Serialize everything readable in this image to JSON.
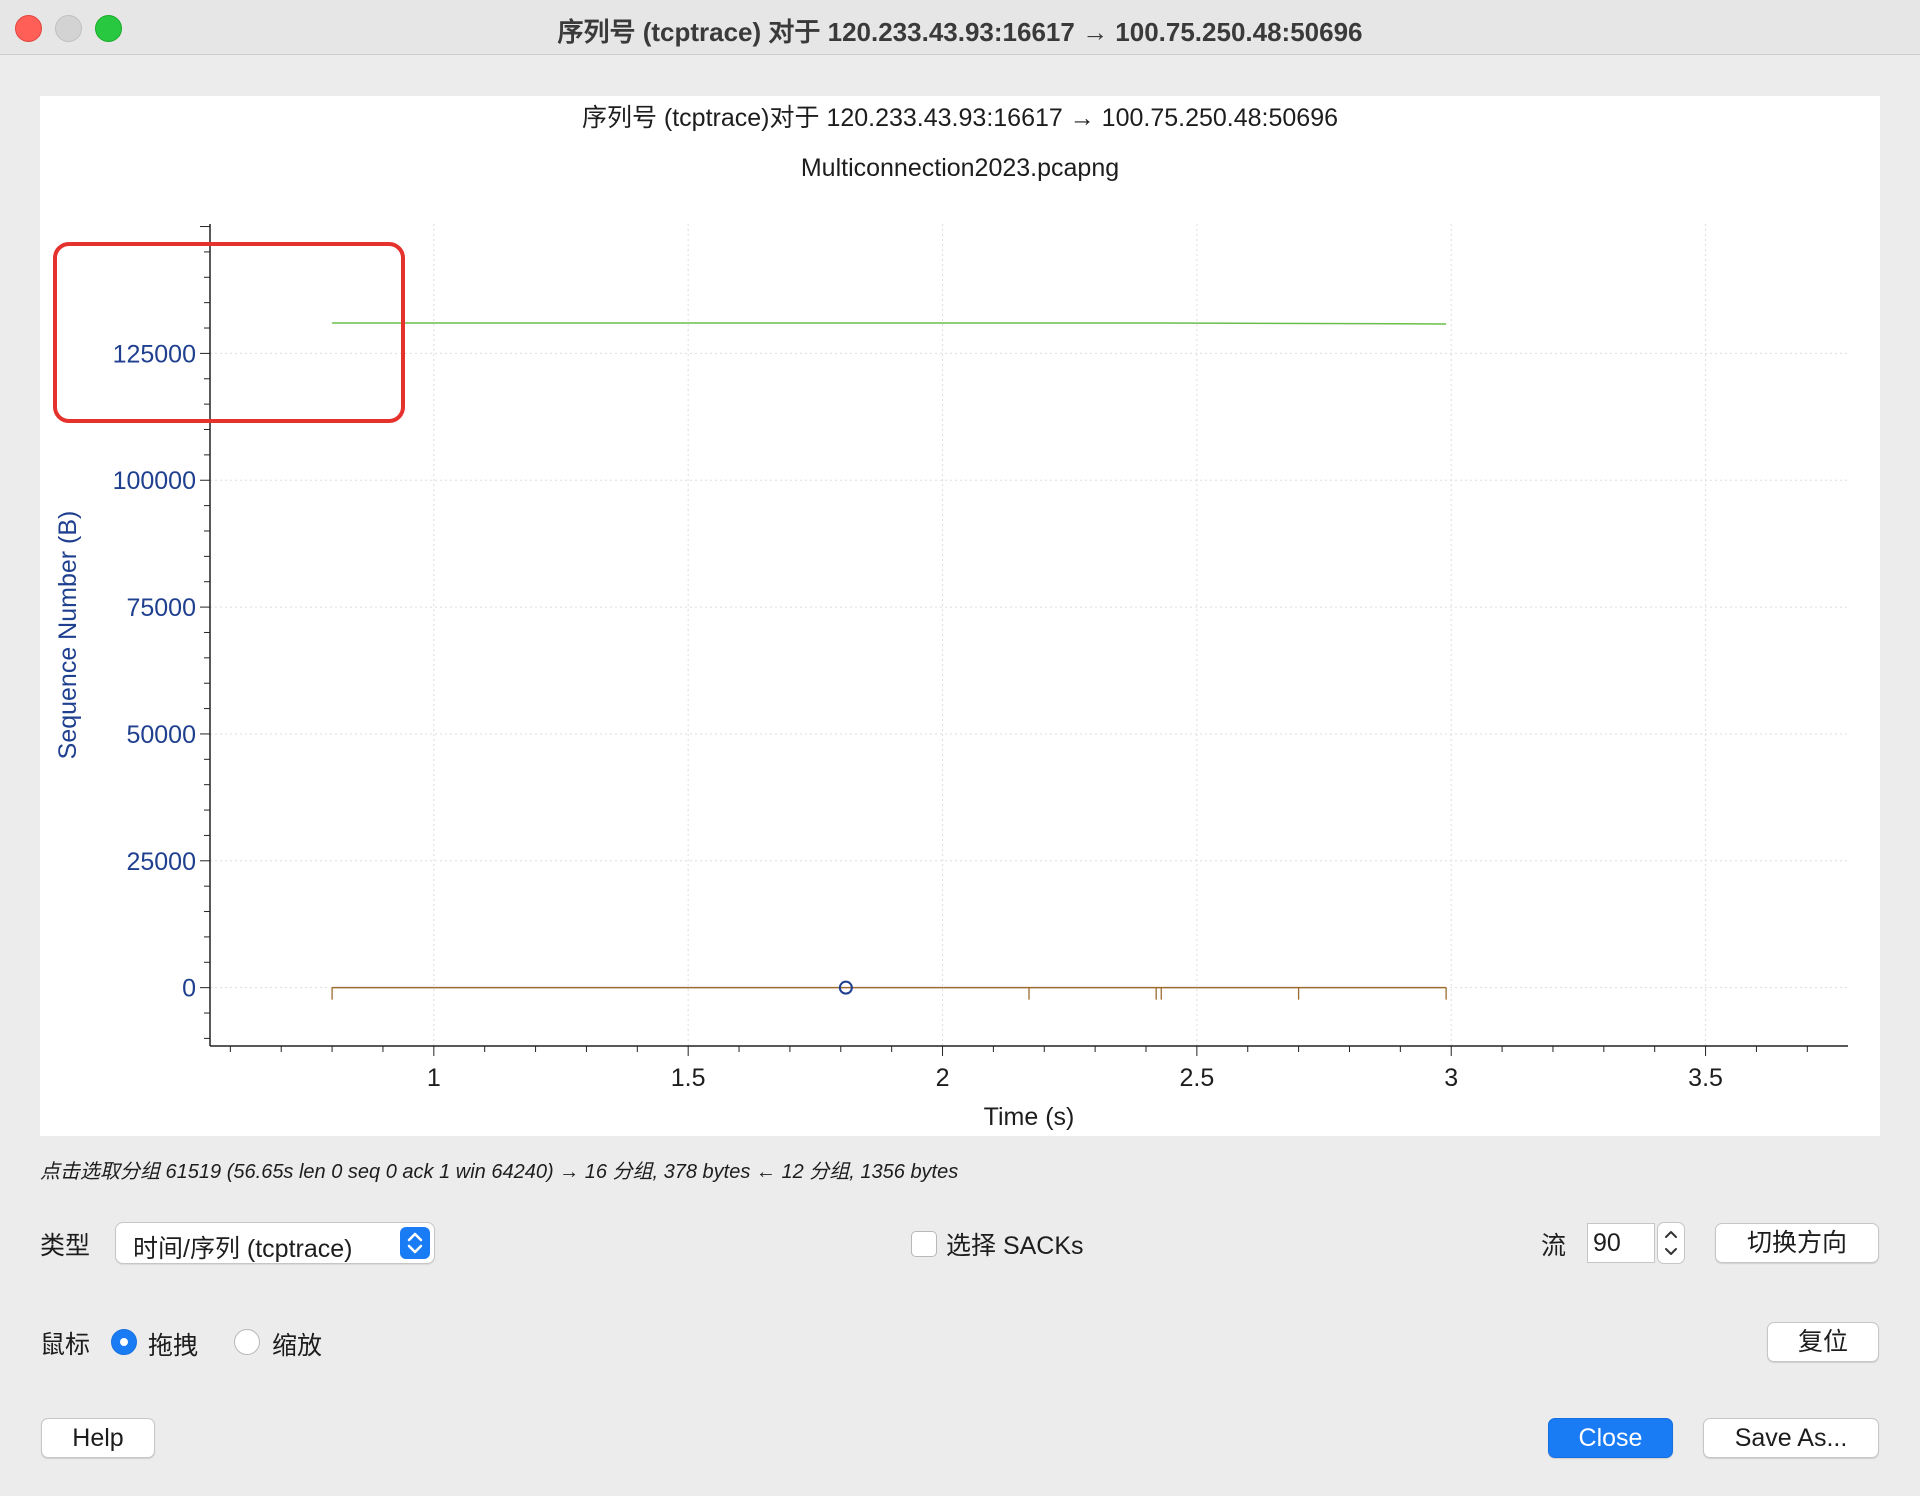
{
  "window": {
    "title": "序列号 (tcptrace) 对于 120.233.43.93:16617 → 100.75.250.48:50696"
  },
  "chart_data": {
    "type": "line",
    "title": "序列号 (tcptrace)对于 120.233.43.93:16617 → 100.75.250.48:50696",
    "subtitle": "Multiconnection2023.pcapng",
    "xlabel": "Time (s)",
    "ylabel": "Sequence Number (B)",
    "xlim": [
      0.56,
      3.78
    ],
    "ylim": [
      -11500,
      150500
    ],
    "x_ticks": [
      1,
      1.5,
      2,
      2.5,
      3,
      3.5
    ],
    "x_tick_labels": [
      "1",
      "1.5",
      "2",
      "2.5",
      "3",
      "3.5"
    ],
    "y_ticks": [
      0,
      25000,
      50000,
      75000,
      100000,
      125000
    ],
    "y_tick_labels": [
      "0",
      "25000",
      "50000",
      "75000",
      "100000",
      "125000"
    ],
    "grid": true,
    "series": [
      {
        "color": "#6abf4b",
        "style": "line",
        "x": [
          0.8,
          1.5,
          2.0,
          2.43,
          2.99
        ],
        "y": [
          131000,
          131000,
          131000,
          131000,
          130800
        ]
      },
      {
        "color": "#9c6b2e",
        "style": "line",
        "x": [
          0.8,
          1.5,
          2.0,
          2.43,
          2.99
        ],
        "y": [
          0,
          0,
          0,
          0,
          0
        ]
      },
      {
        "color": "#9c6b2e",
        "style": "ticks",
        "x": [
          0.8,
          2.17,
          2.42,
          2.43,
          2.7,
          2.99
        ],
        "y": [
          0,
          0,
          0,
          0,
          0,
          0
        ]
      },
      {
        "color": "#1f3f8f",
        "style": "circle",
        "x": [
          1.81
        ],
        "y": [
          0
        ]
      }
    ],
    "annotation_box_color": "#e5322d"
  },
  "status": {
    "text": "点击选取分组 61519 (56.65s len 0 seq 0 ack 1 win 64240) → 16 分组, 378 bytes ← 12 分组, 1356 bytes"
  },
  "controls": {
    "type_label": "类型",
    "type_value": "时间/序列 (tcptrace)",
    "sacks_label": "选择 SACKs",
    "stream_label": "流",
    "stream_value": "90",
    "switch_direction": "切换方向",
    "mouse_label": "鼠标",
    "drag_label": "拖拽",
    "zoom_label": "缩放",
    "reset": "复位",
    "help": "Help",
    "close": "Close",
    "save_as": "Save As..."
  },
  "colors": {
    "accent": "#1a7cf5",
    "axis_text": "#1f3f8f"
  }
}
